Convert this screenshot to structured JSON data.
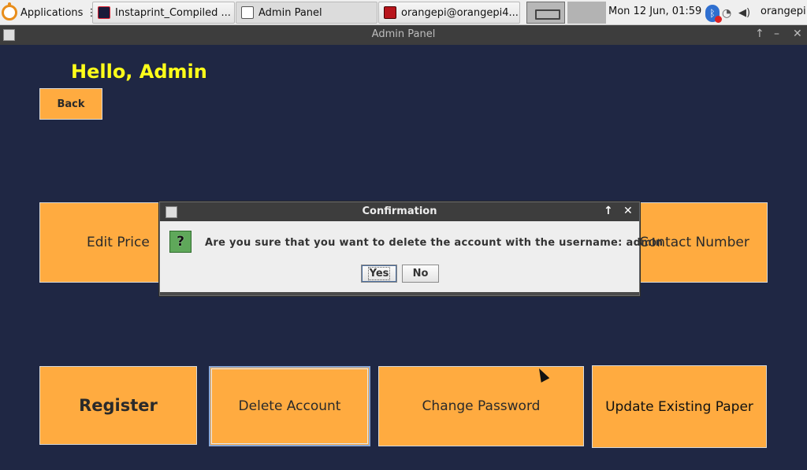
{
  "taskbar": {
    "apps_label": "Applications ⋮",
    "tasks": [
      {
        "label": "Instaprint_Compiled ...",
        "icon": "intellij-icon"
      },
      {
        "label": "Admin Panel",
        "icon": "java-icon"
      },
      {
        "label": "orangepi@orangepi4...",
        "icon": "terminal-icon"
      }
    ],
    "clock": "Mon 12 Jun, 01:59",
    "user": "orangepi"
  },
  "window": {
    "title": "Admin Panel"
  },
  "main": {
    "greeting": "Hello, Admin",
    "back_label": "Back",
    "buttons": {
      "edit_price": "Edit Price",
      "contact_number": "Contact Number",
      "register": "Register",
      "delete_account": "Delete Account",
      "change_password": "Change Password",
      "update_paper": "Update Existing Paper"
    }
  },
  "dialog": {
    "title": "Confirmation",
    "message": "Are you sure that you want to delete the account with the username: admin",
    "icon_symbol": "?",
    "yes_label": "Yes",
    "no_label": "No"
  },
  "colors": {
    "background": "#1f2744",
    "button": "#ffab40",
    "greeting": "#ffff1a",
    "titlebar": "#3d3d3d"
  }
}
